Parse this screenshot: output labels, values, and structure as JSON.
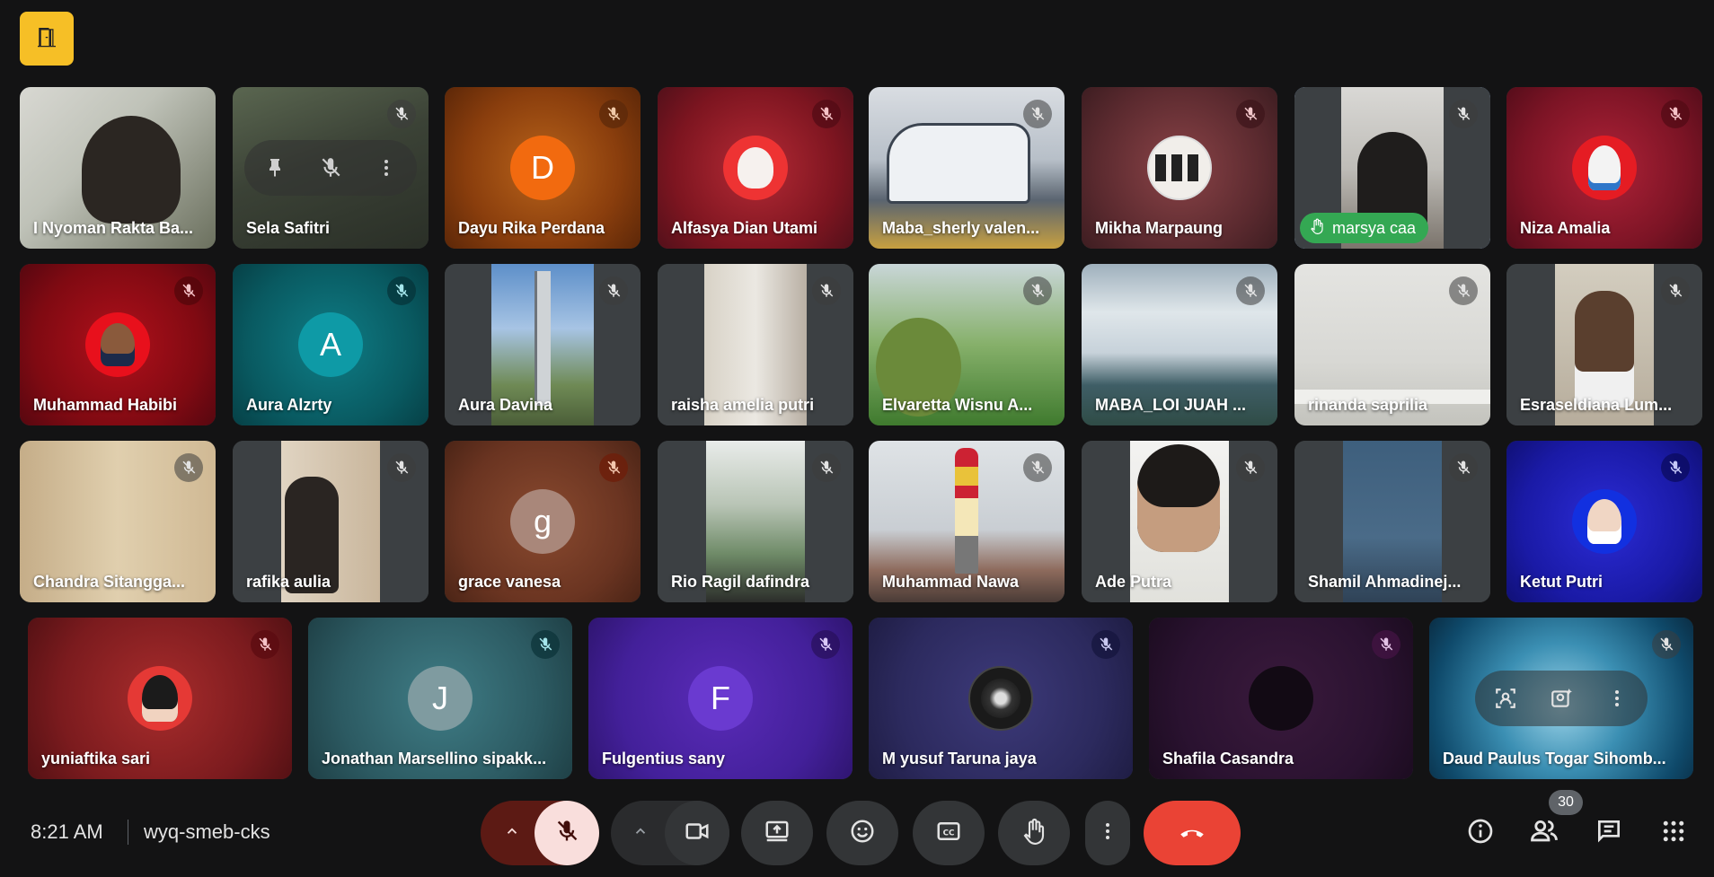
{
  "meeting": {
    "time": "8:21 AM",
    "code": "wyq-smeb-cks",
    "participant_count": "30"
  },
  "participants": [
    {
      "name": "I Nyoman Rakta Ba...",
      "mic_muted": false
    },
    {
      "name": "Sela Safitri",
      "mic_muted": true
    },
    {
      "name": "Dayu Rika Perdana",
      "initial": "D",
      "mic_muted": true
    },
    {
      "name": "Alfasya Dian Utami",
      "mic_muted": true
    },
    {
      "name": "Maba_sherly valen...",
      "mic_muted": true
    },
    {
      "name": "Mikha Marpaung",
      "mic_muted": true
    },
    {
      "name": "marsya caa",
      "mic_muted": true,
      "hand_raised": true
    },
    {
      "name": "Niza Amalia",
      "mic_muted": true
    },
    {
      "name": "Muhammad Habibi",
      "mic_muted": true
    },
    {
      "name": "Aura Alzrty",
      "initial": "A",
      "mic_muted": true
    },
    {
      "name": "Aura Davina",
      "mic_muted": true
    },
    {
      "name": "raisha amelia putri",
      "mic_muted": true
    },
    {
      "name": "Elvaretta Wisnu A...",
      "mic_muted": true
    },
    {
      "name": "MABA_LOI JUAH ...",
      "mic_muted": true
    },
    {
      "name": "rinanda saprilia",
      "mic_muted": true
    },
    {
      "name": "Esraseldiana Lum...",
      "mic_muted": true
    },
    {
      "name": "Chandra Sitangga...",
      "mic_muted": true
    },
    {
      "name": "rafika aulia",
      "mic_muted": true
    },
    {
      "name": "grace vanesa",
      "initial": "g",
      "mic_muted": true
    },
    {
      "name": "Rio Ragil dafindra",
      "mic_muted": true
    },
    {
      "name": "Muhammad Nawa",
      "mic_muted": true
    },
    {
      "name": "Ade Putra",
      "mic_muted": true
    },
    {
      "name": "Shamil Ahmadinej...",
      "mic_muted": true
    },
    {
      "name": "Ketut Putri",
      "mic_muted": true
    },
    {
      "name": "yuniaftika sari",
      "mic_muted": true
    },
    {
      "name": "Jonathan Marsellino sipakk...",
      "initial": "J",
      "mic_muted": true
    },
    {
      "name": "Fulgentius sany",
      "initial": "F",
      "mic_muted": true
    },
    {
      "name": "M yusuf Taruna jaya",
      "mic_muted": true
    },
    {
      "name": "Shafila Casandra",
      "mic_muted": true
    },
    {
      "name": "Daud Paulus Togar Sihomb...",
      "mic_muted": true
    }
  ],
  "icons": {
    "exit": "door-icon",
    "mic_off": "mic-off-icon",
    "hand": "raised-hand-icon",
    "camera": "camera-icon",
    "present": "present-screen-icon",
    "emoji": "emoji-icon",
    "captions": "closed-captions-icon",
    "more": "more-vert-icon",
    "end_call": "call-end-icon",
    "info": "info-icon",
    "people": "people-icon",
    "chat": "chat-icon",
    "activities": "apps-grid-icon"
  },
  "colors": {
    "background": "#131314",
    "end_call": "#ea4335",
    "mic_muted_bg": "#f9dedc",
    "hand_badge": "#34a853",
    "exit_badge": "#f6bf26",
    "highlight_border": "#a8c7fa"
  }
}
